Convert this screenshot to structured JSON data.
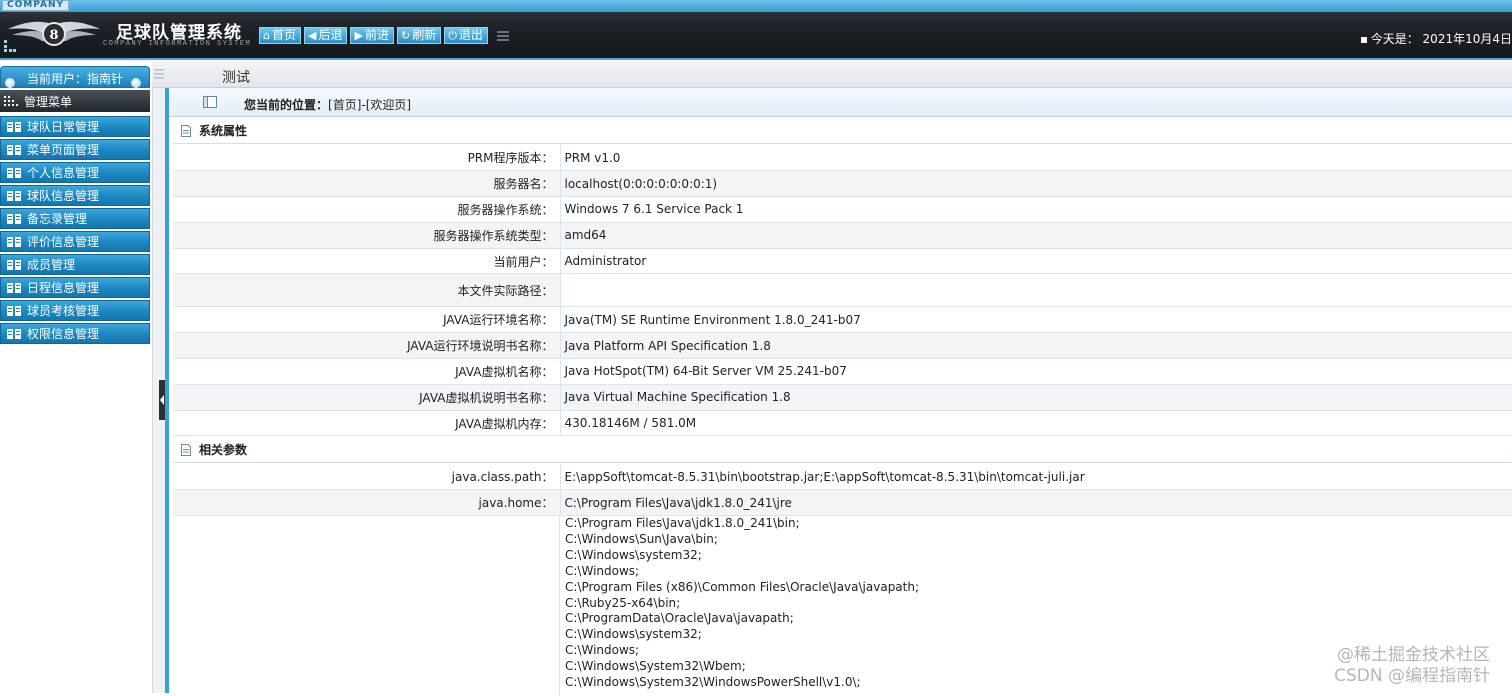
{
  "header": {
    "company_badge": "COMPANY",
    "app_title": "足球队管理系统",
    "app_subtitle": "COMPANY INFORMATION SYSTEM",
    "nav": [
      {
        "label": "首页",
        "icon": "home-icon"
      },
      {
        "label": "后退",
        "icon": "arrow-left-icon"
      },
      {
        "label": "前进",
        "icon": "arrow-right-icon"
      },
      {
        "label": "刷新",
        "icon": "refresh-icon"
      },
      {
        "label": "退出",
        "icon": "power-icon"
      }
    ],
    "date_text": "今天是： 2021年10月4日"
  },
  "subbar": {
    "title": "测试"
  },
  "sidebar": {
    "current_user": "当前用户：指南针",
    "menu_title": "管理菜单",
    "items": [
      {
        "label": "球队日常管理"
      },
      {
        "label": "菜单页面管理"
      },
      {
        "label": "个人信息管理"
      },
      {
        "label": "球队信息管理"
      },
      {
        "label": "备忘录管理"
      },
      {
        "label": "评价信息管理"
      },
      {
        "label": "成员管理"
      },
      {
        "label": "日程信息管理"
      },
      {
        "label": "球员考核管理"
      },
      {
        "label": "权限信息管理"
      }
    ]
  },
  "location": {
    "label": "您当前的位置：",
    "path": "[首页]-[欢迎页]"
  },
  "system_props": {
    "title": "系统属性",
    "rows": [
      {
        "key": "PRM程序版本：",
        "value": "PRM v1.0"
      },
      {
        "key": "服务器名：",
        "value": "localhost(0:0:0:0:0:0:0:1)"
      },
      {
        "key": "服务器操作系统：",
        "value": "Windows 7 6.1 Service Pack 1"
      },
      {
        "key": "服务器操作系统类型：",
        "value": "amd64"
      },
      {
        "key": "当前用户：",
        "value": "Administrator"
      },
      {
        "key": "本文件实际路径：",
        "value": ""
      },
      {
        "key": "JAVA运行环境名称：",
        "value": "Java(TM) SE Runtime Environment 1.8.0_241-b07"
      },
      {
        "key": "JAVA运行环境说明书名称：",
        "value": "Java Platform API Specification 1.8"
      },
      {
        "key": "JAVA虚拟机名称：",
        "value": "Java HotSpot(TM) 64-Bit Server VM 25.241-b07"
      },
      {
        "key": "JAVA虚拟机说明书名称：",
        "value": "Java Virtual Machine Specification 1.8"
      },
      {
        "key": "JAVA虚拟机内存：",
        "value": "430.18146M /  581.0M"
      }
    ]
  },
  "related_params": {
    "title": "相关参数",
    "rows": [
      {
        "key": "java.class.path：",
        "value": "E:\\appSoft\\tomcat-8.5.31\\bin\\bootstrap.jar;E:\\appSoft\\tomcat-8.5.31\\bin\\tomcat-juli.jar"
      },
      {
        "key": "java.home：",
        "value": "C:\\Program Files\\Java\\jdk1.8.0_241\\jre"
      }
    ],
    "library_path_lines": "C:\\Program Files\\Java\\jdk1.8.0_241\\bin;\nC:\\Windows\\Sun\\Java\\bin;\nC:\\Windows\\system32;\nC:\\Windows;\nC:\\Program Files (x86)\\Common Files\\Oracle\\Java\\javapath;\nC:\\Ruby25-x64\\bin;\nC:\\ProgramData\\Oracle\\Java\\javapath;\nC:\\Windows\\system32;\nC:\\Windows;\nC:\\Windows\\System32\\Wbem;\nC:\\Windows\\System32\\WindowsPowerShell\\v1.0\\;"
  },
  "watermark": {
    "line1": "@稀土掘金技术社区",
    "line2": "CSDN @编程指南针"
  },
  "colors": {
    "accent": "#37a2d8",
    "header_dark": "#1f2328",
    "menu_blue": "#1d86c0"
  }
}
